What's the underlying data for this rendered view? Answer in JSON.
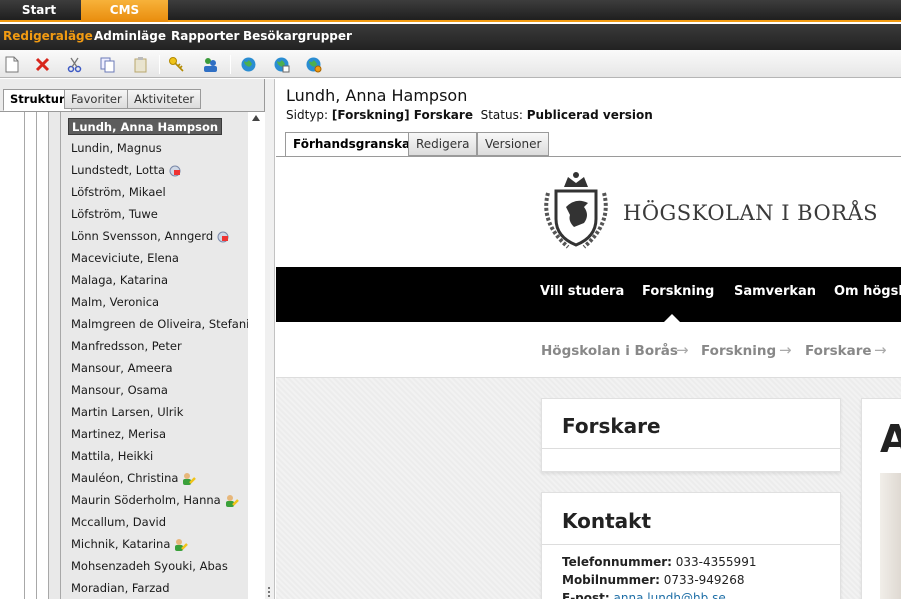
{
  "topbar": {
    "tabs": [
      {
        "label": "Start"
      },
      {
        "label": "CMS"
      }
    ]
  },
  "menubar": {
    "items": [
      {
        "label": "Redigeraläge"
      },
      {
        "label": "Adminläge"
      },
      {
        "label": "Rapporter"
      },
      {
        "label": "Besökargrupper"
      }
    ]
  },
  "leftpanel": {
    "tabs": [
      {
        "label": "Struktur"
      },
      {
        "label": "Favoriter"
      },
      {
        "label": "Aktiviteter"
      }
    ],
    "tree": [
      {
        "label": "Lundh, Anna Hampson",
        "selected": true
      },
      {
        "label": "Lundin, Magnus"
      },
      {
        "label": "Lundstedt, Lotta",
        "badge": "lock-icon"
      },
      {
        "label": "Löfström, Mikael"
      },
      {
        "label": "Löfström, Tuwe"
      },
      {
        "label": "Lönn Svensson, Anngerd",
        "badge": "lock-icon"
      },
      {
        "label": "Maceviciute, Elena"
      },
      {
        "label": "Malaga, Katarina"
      },
      {
        "label": "Malm, Veronica"
      },
      {
        "label": "Malmgreen de Oliveira, Stefanie"
      },
      {
        "label": "Manfredsson, Peter"
      },
      {
        "label": "Mansour, Ameera"
      },
      {
        "label": "Mansour, Osama"
      },
      {
        "label": "Martin Larsen, Ulrik"
      },
      {
        "label": "Martinez, Merisa"
      },
      {
        "label": "Mattila, Heikki"
      },
      {
        "label": "Mauléon, Christina",
        "badge": "user-edit-icon"
      },
      {
        "label": "Maurin Söderholm, Hanna",
        "badge": "user-edit-icon"
      },
      {
        "label": "Mccallum, David"
      },
      {
        "label": "Michnik, Katarina",
        "badge": "user-edit-icon"
      },
      {
        "label": "Mohsenzadeh Syouki, Abas"
      },
      {
        "label": "Moradian, Farzad"
      }
    ]
  },
  "page": {
    "title": "Lundh, Anna Hampson",
    "pagetype_label": "Sidtyp:",
    "pagetype_value": "[Forskning] Forskare",
    "status_label": "Status:",
    "status_value": "Publicerad version",
    "tabs": [
      {
        "label": "Förhandsgranska"
      },
      {
        "label": "Redigera"
      },
      {
        "label": "Versioner"
      }
    ]
  },
  "preview": {
    "logo_text": "HÖGSKOLAN I BORÅS",
    "nav": [
      {
        "label": "Vill studera"
      },
      {
        "label": "Forskning"
      },
      {
        "label": "Samverkan"
      },
      {
        "label": "Om högsko"
      }
    ],
    "breadcrumb": [
      {
        "label": "Högskolan i Borås"
      },
      {
        "label": "Forskning"
      },
      {
        "label": "Forskare"
      }
    ],
    "breadcrumb_arrow": "→",
    "forskare_card_title": "Forskare",
    "kontakt_card_title": "Kontakt",
    "contact": {
      "phone_label": "Telefonnummer:",
      "phone": "033-4355991",
      "mobile_label": "Mobilnummer:",
      "mobile": "0733-949268",
      "email_label": "E-post:",
      "email": "anna.lundh@hb.se"
    },
    "profile_initial": "A"
  },
  "colors": {
    "accent": "#f29b12",
    "navbar": "#000000",
    "link": "#1d6ea6"
  }
}
